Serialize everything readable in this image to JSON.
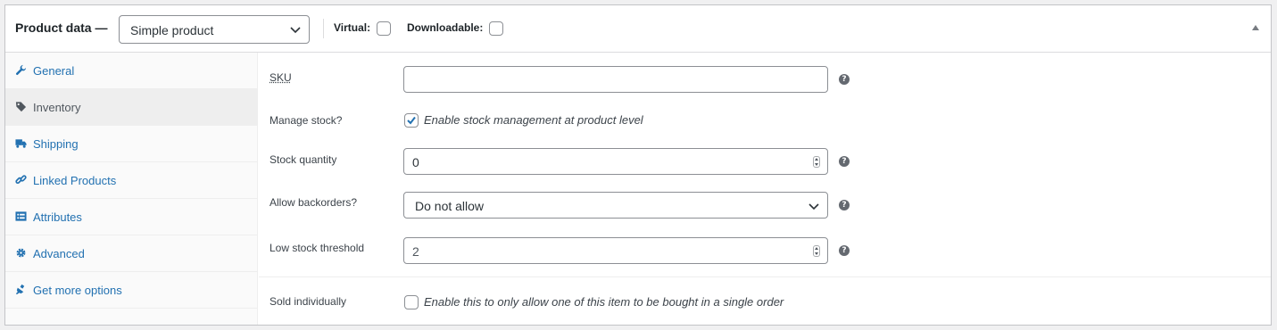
{
  "header": {
    "title": "Product data —",
    "product_type": "Simple product",
    "virtual_label": "Virtual:",
    "downloadable_label": "Downloadable:"
  },
  "tabs": [
    {
      "label": "General",
      "icon": "wrench-icon"
    },
    {
      "label": "Inventory",
      "icon": "tag-icon",
      "active": true
    },
    {
      "label": "Shipping",
      "icon": "truck-icon"
    },
    {
      "label": "Linked Products",
      "icon": "link-icon"
    },
    {
      "label": "Attributes",
      "icon": "list-icon"
    },
    {
      "label": "Advanced",
      "icon": "gear-icon"
    },
    {
      "label": "Get more options",
      "icon": "plugin-icon"
    }
  ],
  "inventory": {
    "sku_label": "SKU",
    "sku_value": "",
    "manage_stock_label": "Manage stock?",
    "manage_stock_checked": true,
    "manage_stock_desc": "Enable stock management at product level",
    "stock_qty_label": "Stock quantity",
    "stock_qty_value": "0",
    "backorders_label": "Allow backorders?",
    "backorders_value": "Do not allow",
    "low_stock_label": "Low stock threshold",
    "low_stock_value": "2",
    "sold_individually_label": "Sold individually",
    "sold_individually_checked": false,
    "sold_individually_desc": "Enable this to only allow one of this item to be bought in a single order"
  },
  "help_glyph": "?",
  "colors": {
    "link": "#2271b1",
    "accent_check": "#2271b1",
    "border": "#8c8f94"
  }
}
